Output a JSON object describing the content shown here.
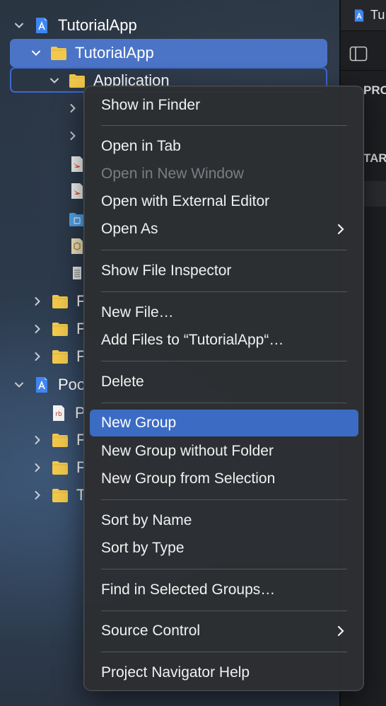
{
  "navigator": {
    "rows": [
      {
        "label": "TutorialApp",
        "kind": "project",
        "expanded": true
      },
      {
        "label": "TutorialApp",
        "kind": "folder",
        "expanded": true,
        "selected": true
      },
      {
        "label": "Application",
        "kind": "folder",
        "expanded": true,
        "focused": true
      },
      {
        "label": "",
        "kind": "collapsed"
      },
      {
        "label": "",
        "kind": "collapsed"
      },
      {
        "label": "",
        "kind": "swift-file"
      },
      {
        "label": "",
        "kind": "swift-file"
      },
      {
        "label": "",
        "kind": "assets-file"
      },
      {
        "label": "",
        "kind": "plist-file"
      },
      {
        "label": "",
        "kind": "text-file"
      },
      {
        "label": "F",
        "kind": "folder",
        "expanded": false
      },
      {
        "label": "F",
        "kind": "folder",
        "expanded": false
      },
      {
        "label": "F",
        "kind": "folder",
        "expanded": false
      },
      {
        "label": "Poo",
        "kind": "project",
        "expanded": true
      },
      {
        "label": "P",
        "kind": "ruby-file"
      },
      {
        "label": "F",
        "kind": "folder",
        "expanded": false
      },
      {
        "label": "P",
        "kind": "folder",
        "expanded": false
      },
      {
        "label": "T",
        "kind": "folder",
        "expanded": false
      }
    ]
  },
  "editor": {
    "tab_label": "Tu",
    "section_label_1": "PRO",
    "section_label_2": "TAR"
  },
  "context_menu": {
    "items": [
      {
        "label": "Show in Finder"
      },
      {
        "label": "Open in Tab"
      },
      {
        "label": "Open in New Window",
        "disabled": true
      },
      {
        "label": "Open with External Editor"
      },
      {
        "label": "Open As",
        "submenu": true
      },
      {
        "label": "Show File Inspector"
      },
      {
        "label": "New File…"
      },
      {
        "label": "Add Files to “TutorialApp“…"
      },
      {
        "label": "Delete"
      },
      {
        "label": "New Group",
        "highlighted": true
      },
      {
        "label": "New Group without Folder"
      },
      {
        "label": "New Group from Selection"
      },
      {
        "label": "Sort by Name"
      },
      {
        "label": "Sort by Type"
      },
      {
        "label": "Find in Selected Groups…"
      },
      {
        "label": "Source Control",
        "submenu": true
      },
      {
        "label": "Project Navigator Help"
      }
    ]
  },
  "colors": {
    "selection": "#4b74c6",
    "menu_highlight": "#3c6bc4",
    "folder": "#f2c94c",
    "project_icon": "#4e8ef7"
  }
}
